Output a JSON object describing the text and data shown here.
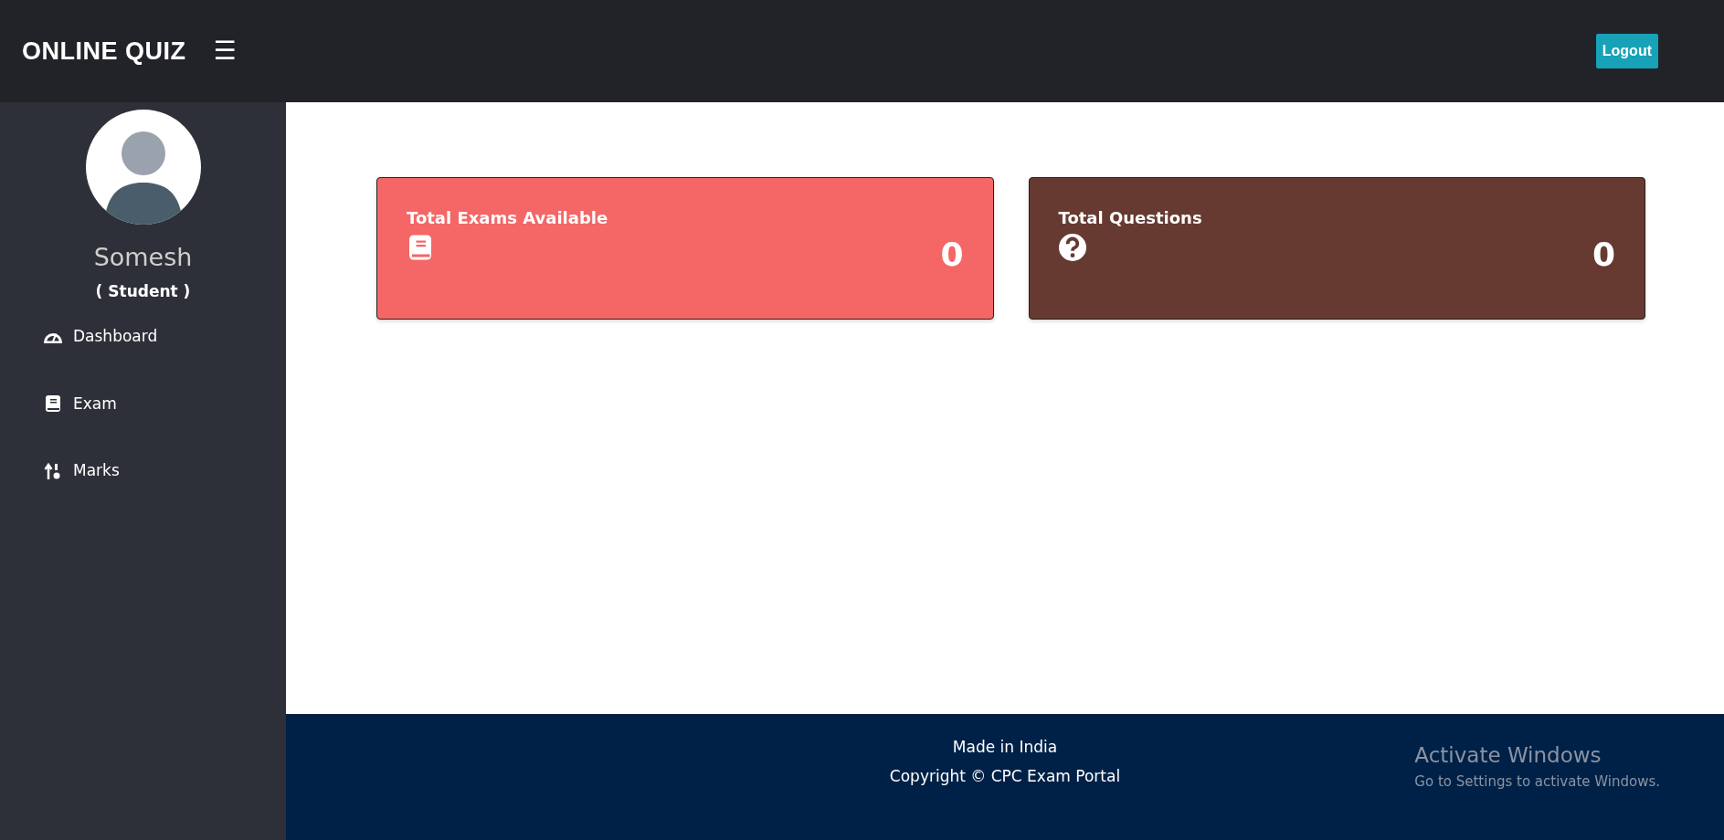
{
  "brand": {
    "title": "ONLINE QUIZ",
    "menu_glyph": "☰"
  },
  "header": {
    "logout": "Logout"
  },
  "profile": {
    "name": "Somesh",
    "role": "( Student )"
  },
  "sidebar": {
    "items": [
      {
        "label": "Dashboard"
      },
      {
        "label": "Exam"
      },
      {
        "label": "Marks"
      }
    ]
  },
  "cards": [
    {
      "title": "Total Exams Available",
      "value": "0",
      "color": "#f56666"
    },
    {
      "title": "Total Questions",
      "value": "0",
      "color": "#663a31"
    }
  ],
  "footer": {
    "lines": [
      "Made in India",
      "Copyright © CPC Exam Portal"
    ]
  },
  "os_notice": {
    "title": "Activate Windows",
    "text": "Go to Settings to activate Windows."
  }
}
